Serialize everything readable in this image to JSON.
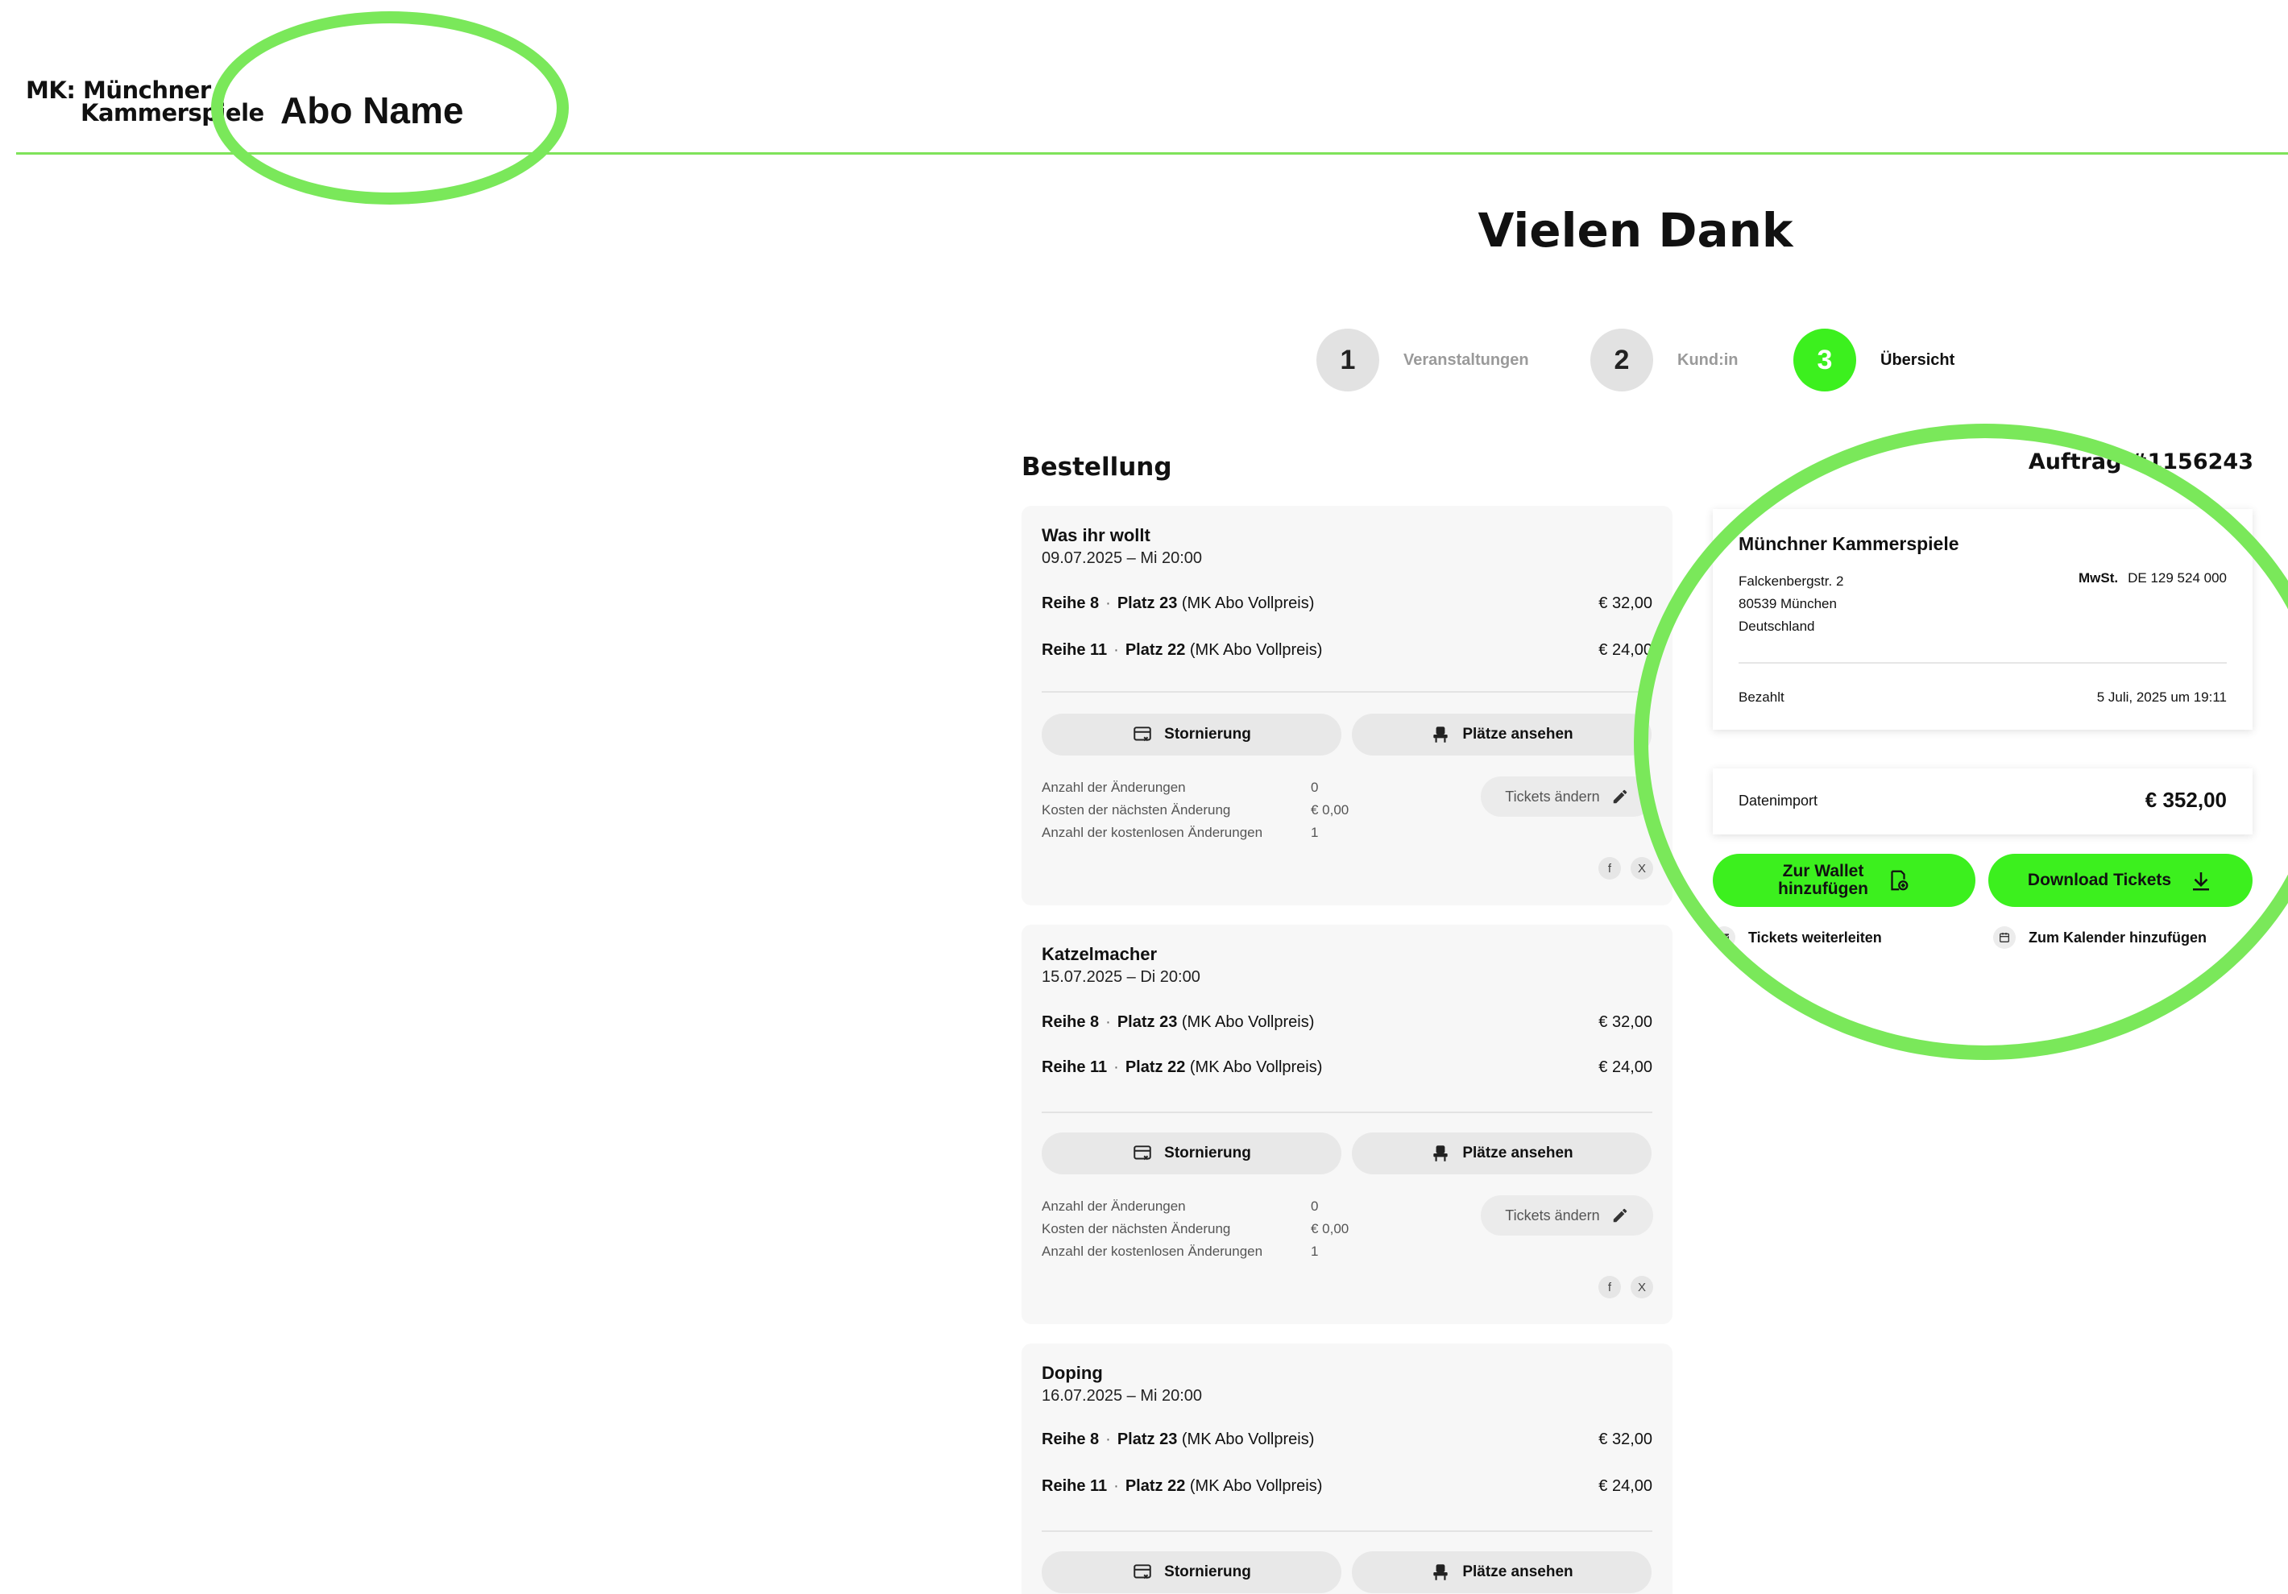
{
  "header": {
    "logo_line1": "MK: Münchner",
    "logo_line2": "Kammerspiele",
    "abo_name": "Abo Name"
  },
  "page": {
    "title": "Vielen Dank",
    "section_title": "Bestellung",
    "order_id": "Auftrag #1156243"
  },
  "steps": [
    {
      "number": "1",
      "label": "Veranstaltungen",
      "active": false
    },
    {
      "number": "2",
      "label": "Kund:in",
      "active": false
    },
    {
      "number": "3",
      "label": "Übersicht",
      "active": true
    }
  ],
  "labels": {
    "cancel": "Stornierung",
    "view_seats": "Plätze ansehen",
    "change_tickets": "Tickets ändern",
    "stat_changes": "Anzahl der Änderungen",
    "stat_next_cost": "Kosten der nächsten Änderung",
    "stat_free_changes": "Anzahl der kostenlosen Änderungen",
    "facebook": "f",
    "x": "X"
  },
  "events": [
    {
      "title": "Was ihr wollt",
      "date": "09.07.2025 – Mi 20:00",
      "tickets": [
        {
          "row": "Reihe 8",
          "seat": "Platz 23",
          "tariff": "(MK Abo Vollpreis)",
          "price": "€ 32,00"
        },
        {
          "row": "Reihe 11",
          "seat": "Platz 22",
          "tariff": "(MK Abo Vollpreis)",
          "price": "€ 24,00"
        }
      ],
      "stats": {
        "changes": "0",
        "next_cost": "€ 0,00",
        "free_changes": "1"
      }
    },
    {
      "title": "Katzelmacher",
      "date": "15.07.2025 – Di 20:00",
      "tickets": [
        {
          "row": "Reihe 8",
          "seat": "Platz 23",
          "tariff": "(MK Abo Vollpreis)",
          "price": "€ 32,00"
        },
        {
          "row": "Reihe 11",
          "seat": "Platz 22",
          "tariff": "(MK Abo Vollpreis)",
          "price": "€ 24,00"
        }
      ],
      "stats": {
        "changes": "0",
        "next_cost": "€ 0,00",
        "free_changes": "1"
      }
    },
    {
      "title": "Doping",
      "date": "16.07.2025 – Mi 20:00",
      "tickets": [
        {
          "row": "Reihe 8",
          "seat": "Platz 23",
          "tariff": "(MK Abo Vollpreis)",
          "price": "€ 32,00"
        },
        {
          "row": "Reihe 11",
          "seat": "Platz 22",
          "tariff": "(MK Abo Vollpreis)",
          "price": "€ 24,00"
        }
      ]
    }
  ],
  "summary": {
    "org": "Münchner Kammerspiele",
    "street": "Falckenbergstr. 2",
    "city": "80539 München",
    "country": "Deutschland",
    "vat_label": "MwSt.",
    "vat_value": "DE 129 524 000",
    "paid_label": "Bezahlt",
    "paid_date": "5 Juli, 2025 um 19:11",
    "total_label": "Datenimport",
    "total_value": "€ 352,00",
    "wallet_line1": "Zur Wallet",
    "wallet_line2": "hinzufügen",
    "download": "Download Tickets",
    "forward": "Tickets weiterleiten",
    "calendar": "Zum Kalender hinzufügen"
  },
  "colors": {
    "accent_green": "#3cf01e",
    "annotation_ring": "#7ae85a"
  }
}
